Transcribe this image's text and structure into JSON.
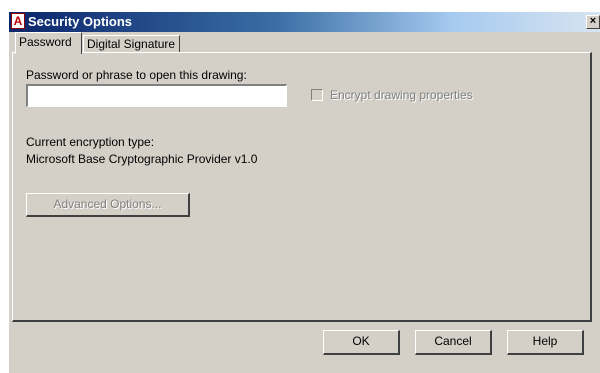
{
  "window": {
    "title": "Security Options",
    "app_icon_letter": "A",
    "close_glyph": "×"
  },
  "tabs": [
    {
      "label": "Password",
      "selected": true
    },
    {
      "label": "Digital Signature",
      "selected": false
    }
  ],
  "password_tab": {
    "password_label": "Password or phrase to open this drawing:",
    "password_value": "",
    "encrypt_label": "Encrypt drawing properties",
    "encrypt_checked": false,
    "encrypt_enabled": false,
    "encryption_type_label": "Current encryption type:",
    "encryption_type_value": "Microsoft Base Cryptographic Provider v1.0",
    "advanced_button_label": "Advanced Options..."
  },
  "buttons": {
    "ok": "OK",
    "cancel": "Cancel",
    "help": "Help"
  },
  "colors": {
    "dialog_face": "#d4d0c8",
    "titlebar_start": "#0a246a",
    "titlebar_end": "#a6caf0",
    "disabled_text": "#808080"
  },
  "icons": {
    "app": "autocad-icon",
    "close": "close-icon"
  }
}
